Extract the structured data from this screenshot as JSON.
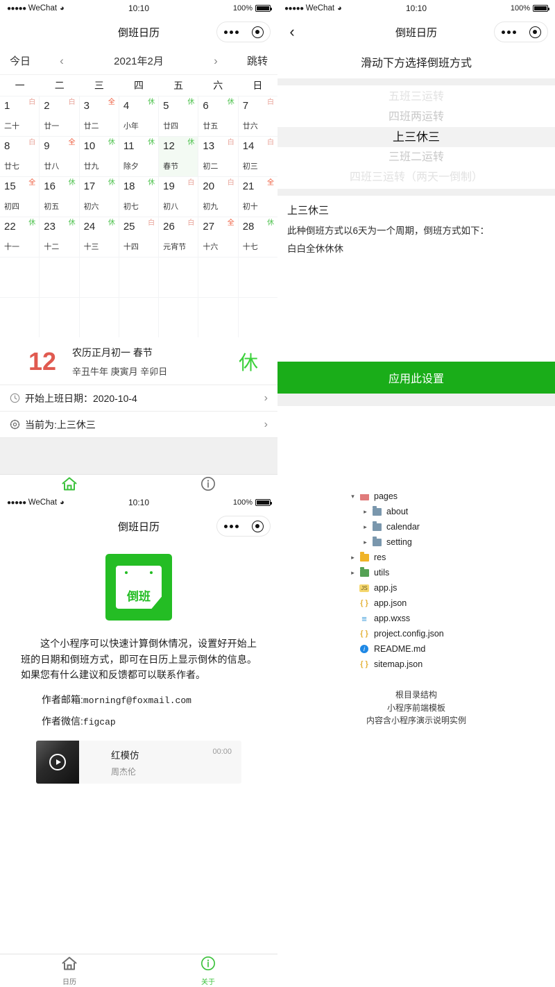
{
  "colors": {
    "brand_green": "#1aad19",
    "tab_active": "#3bc13b",
    "day_red": "#e05a50",
    "mark_bai": "#e8a398",
    "mark_quan": "#ee5a3a",
    "mark_xiu": "#4ec24e"
  },
  "status_bar": {
    "dots": "●●●●●",
    "carrier": "WeChat",
    "wifi_icon": "wifi-icon",
    "time": "10:10",
    "battery_percent": "100%"
  },
  "calendar_page": {
    "nav_title": "倒班日历",
    "toolbar": {
      "today": "今日",
      "prev": "‹",
      "month": "2021年2月",
      "next": "›",
      "jump": "跳转"
    },
    "weekdays": [
      "一",
      "二",
      "三",
      "四",
      "五",
      "六",
      "日"
    ],
    "days": [
      {
        "n": "1",
        "lunar": "二十",
        "mark": "白",
        "type": "bai"
      },
      {
        "n": "2",
        "lunar": "廿一",
        "mark": "白",
        "type": "bai"
      },
      {
        "n": "3",
        "lunar": "廿二",
        "mark": "全",
        "type": "quan"
      },
      {
        "n": "4",
        "lunar": "小年",
        "mark": "休",
        "type": "xiu"
      },
      {
        "n": "5",
        "lunar": "廿四",
        "mark": "休",
        "type": "xiu"
      },
      {
        "n": "6",
        "lunar": "廿五",
        "mark": "休",
        "type": "xiu"
      },
      {
        "n": "7",
        "lunar": "廿六",
        "mark": "白",
        "type": "bai"
      },
      {
        "n": "8",
        "lunar": "廿七",
        "mark": "白",
        "type": "bai"
      },
      {
        "n": "9",
        "lunar": "廿八",
        "mark": "全",
        "type": "quan"
      },
      {
        "n": "10",
        "lunar": "廿九",
        "mark": "休",
        "type": "xiu"
      },
      {
        "n": "11",
        "lunar": "除夕",
        "mark": "休",
        "type": "xiu"
      },
      {
        "n": "12",
        "lunar": "春节",
        "mark": "休",
        "type": "xiu",
        "selected": true
      },
      {
        "n": "13",
        "lunar": "初二",
        "mark": "白",
        "type": "bai"
      },
      {
        "n": "14",
        "lunar": "初三",
        "mark": "白",
        "type": "bai"
      },
      {
        "n": "15",
        "lunar": "初四",
        "mark": "全",
        "type": "quan"
      },
      {
        "n": "16",
        "lunar": "初五",
        "mark": "休",
        "type": "xiu"
      },
      {
        "n": "17",
        "lunar": "初六",
        "mark": "休",
        "type": "xiu"
      },
      {
        "n": "18",
        "lunar": "初七",
        "mark": "休",
        "type": "xiu"
      },
      {
        "n": "19",
        "lunar": "初八",
        "mark": "白",
        "type": "bai"
      },
      {
        "n": "20",
        "lunar": "初九",
        "mark": "白",
        "type": "bai"
      },
      {
        "n": "21",
        "lunar": "初十",
        "mark": "全",
        "type": "quan"
      },
      {
        "n": "22",
        "lunar": "十一",
        "mark": "休",
        "type": "xiu"
      },
      {
        "n": "23",
        "lunar": "十二",
        "mark": "休",
        "type": "xiu"
      },
      {
        "n": "24",
        "lunar": "十三",
        "mark": "休",
        "type": "xiu"
      },
      {
        "n": "25",
        "lunar": "十四",
        "mark": "白",
        "type": "bai"
      },
      {
        "n": "26",
        "lunar": "元宵节",
        "mark": "白",
        "type": "bai"
      },
      {
        "n": "27",
        "lunar": "十六",
        "mark": "全",
        "type": "quan"
      },
      {
        "n": "28",
        "lunar": "十七",
        "mark": "休",
        "type": "xiu"
      }
    ],
    "empty_cells": 14,
    "detail": {
      "day_number": "12",
      "line1": "农历正月初一  春节",
      "line2": "辛丑牛年  庚寅月  辛卯日",
      "tag": "休"
    },
    "rows": [
      {
        "icon": "clock-icon",
        "label": "开始上班日期：2020-10-4",
        "arrow": "›"
      },
      {
        "icon": "gear-icon",
        "label": "当前为:上三休三",
        "arrow": "›"
      }
    ]
  },
  "shift_page": {
    "nav_title": "倒班日历",
    "back_icon": "back-chevron-icon",
    "hint": "滑动下方选择倒班方式",
    "picker_options": [
      "五班三运转",
      "四班两运转",
      "上三休三",
      "三班二运转",
      "四班三运转（两天一倒制）"
    ],
    "picker_selected_index": 2,
    "description": {
      "title": "上三休三",
      "line1": "此种倒班方式以6天为一个周期，倒班方式如下：",
      "line2": "白白全休休休"
    },
    "apply_button": "应用此设置"
  },
  "file_tree": {
    "items": [
      {
        "depth": 0,
        "twisty": "▾",
        "icon": "folder-pink-icon",
        "name": "pages"
      },
      {
        "depth": 1,
        "twisty": "▸",
        "icon": "folder-blue-icon",
        "name": "about"
      },
      {
        "depth": 1,
        "twisty": "▸",
        "icon": "folder-blue-icon",
        "name": "calendar"
      },
      {
        "depth": 1,
        "twisty": "▸",
        "icon": "folder-blue-icon",
        "name": "setting"
      },
      {
        "depth": 0,
        "twisty": "▸",
        "icon": "folder-orange-icon",
        "name": "res"
      },
      {
        "depth": 0,
        "twisty": "▸",
        "icon": "folder-green-icon",
        "name": "utils"
      },
      {
        "depth": 0,
        "twisty": "",
        "icon": "js-file-icon",
        "name": "app.js"
      },
      {
        "depth": 0,
        "twisty": "",
        "icon": "json-file-icon",
        "name": "app.json"
      },
      {
        "depth": 0,
        "twisty": "",
        "icon": "wxss-file-icon",
        "name": "app.wxss"
      },
      {
        "depth": 0,
        "twisty": "",
        "icon": "json-file-icon",
        "name": "project.config.json"
      },
      {
        "depth": 0,
        "twisty": "",
        "icon": "markdown-file-icon",
        "name": "README.md"
      },
      {
        "depth": 0,
        "twisty": "",
        "icon": "json-file-icon",
        "name": "sitemap.json"
      }
    ],
    "caption": [
      "根目录结构",
      "小程序前端模板",
      "内容含小程序演示说明实例"
    ]
  },
  "about_page": {
    "nav_title": "倒班日历",
    "logo_text": "倒班",
    "paragraph": "这个小程序可以快速计算倒休情况，设置好开始上班的日期和倒班方式，即可在日历上显示倒休的信息。如果您有什么建议和反馈都可以联系作者。",
    "email_label": "作者邮箱:",
    "email_value": "morningf@foxmail.com",
    "wechat_label": "作者微信:",
    "wechat_value": "figcap",
    "player": {
      "title": "红模仿",
      "artist": "周杰伦",
      "time": "00:00",
      "play_icon": "play-icon"
    }
  },
  "tabbar": {
    "tabs": [
      {
        "icon": "home-icon",
        "label": "日历"
      },
      {
        "icon": "info-icon",
        "label": "关于"
      }
    ],
    "calendar_active_index": 0,
    "about_active_index": 1
  }
}
